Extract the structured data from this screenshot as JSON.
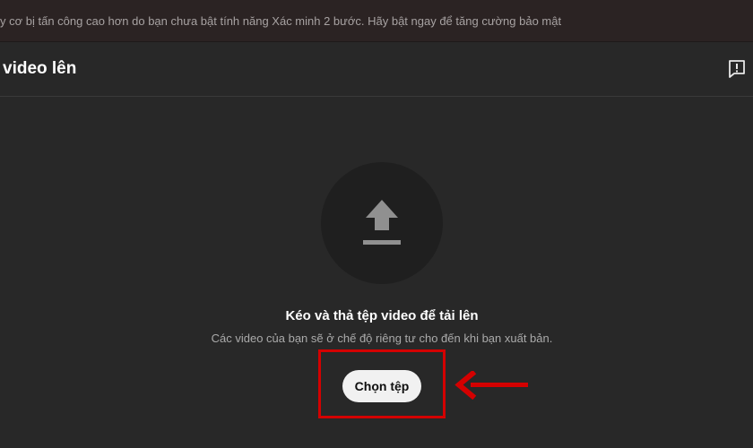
{
  "banner": {
    "message": "y cơ bị tấn công cao hơn do bạn chưa bật tính năng Xác minh 2 bước. Hãy bật ngay để tăng cường bảo mật"
  },
  "dialog": {
    "title": "video lên",
    "feedback_icon": "feedback-icon"
  },
  "upload": {
    "icon": "upload-icon",
    "title": "Kéo và thả tệp video để tải lên",
    "subtitle": "Các video của bạn sẽ ở chế độ riêng tư cho đến khi bạn xuất bản.",
    "button_label": "Chọn tệp"
  },
  "colors": {
    "background": "#282828",
    "banner_background": "#2b2323",
    "circle": "#1f1f1f",
    "icon": "#909090",
    "button": "#f1f1f1",
    "annotation_red": "#d40000"
  }
}
